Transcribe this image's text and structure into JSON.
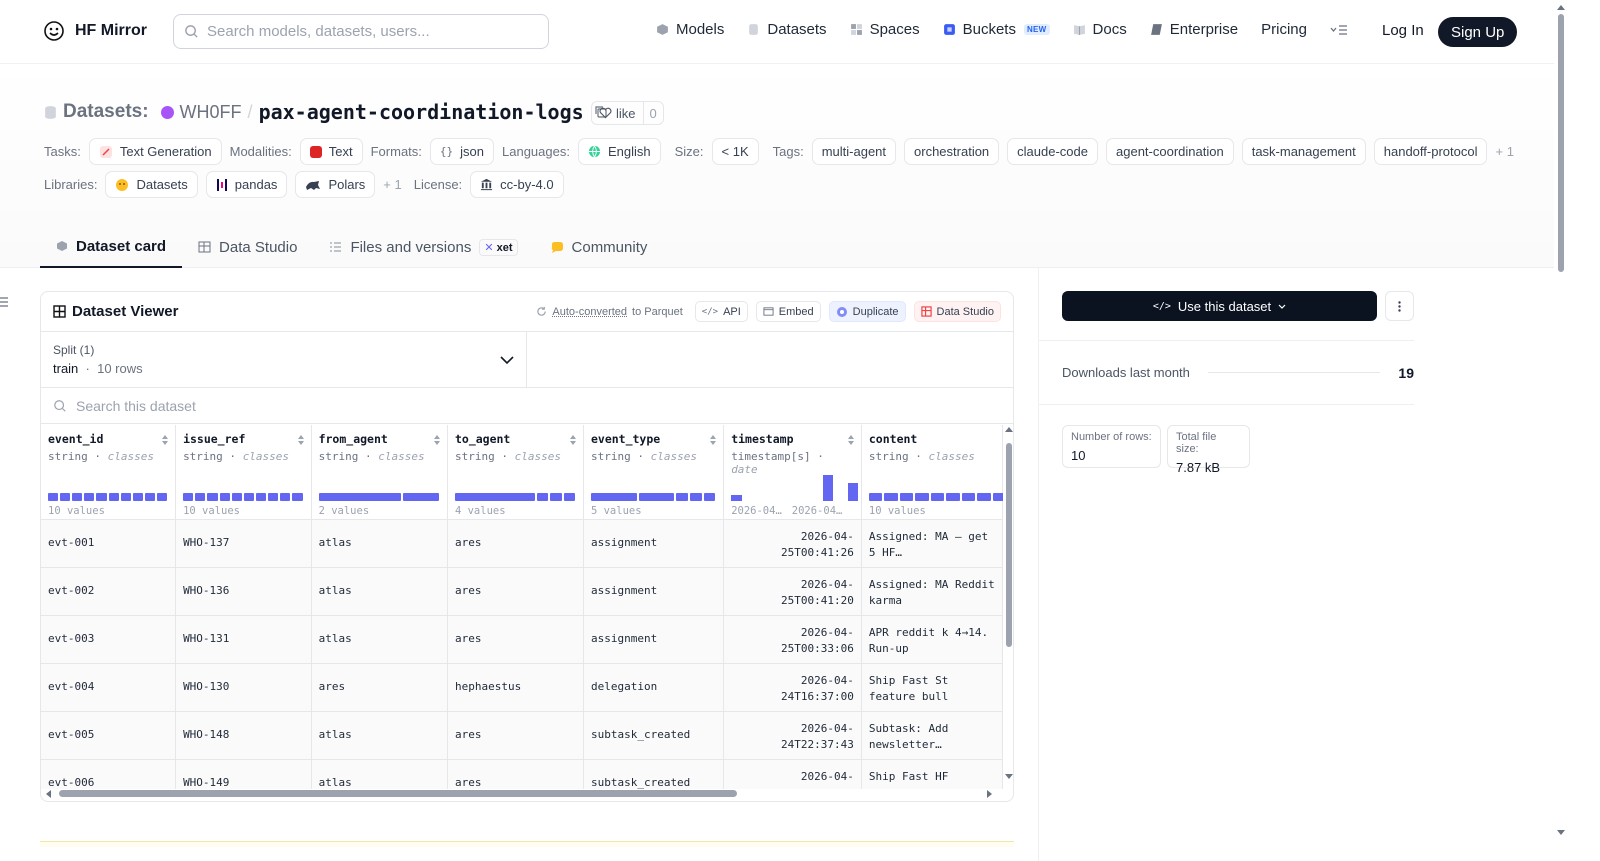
{
  "nav": {
    "brand": "HF Mirror",
    "search_placeholder": "Search models, datasets, users...",
    "items": [
      {
        "label": "Models",
        "icon": "models-icon"
      },
      {
        "label": "Datasets",
        "icon": "datasets-icon"
      },
      {
        "label": "Spaces",
        "icon": "spaces-icon"
      },
      {
        "label": "Buckets",
        "icon": "buckets-icon",
        "badge": "NEW"
      },
      {
        "label": "Docs",
        "icon": "docs-icon"
      },
      {
        "label": "Enterprise",
        "icon": "enterprise-icon"
      },
      {
        "label": "Pricing"
      }
    ],
    "login": "Log In",
    "signup": "Sign Up"
  },
  "header": {
    "type_label": "Datasets:",
    "owner": "WH0FF",
    "separator": "/",
    "name": "pax-agent-coordination-logs",
    "like_label": "like",
    "like_count": "0"
  },
  "tags": {
    "tasks_key": "Tasks:",
    "tasks": [
      "Text Generation"
    ],
    "modalities_key": "Modalities:",
    "modalities": [
      "Text"
    ],
    "formats_key": "Formats:",
    "formats": [
      "json"
    ],
    "languages_key": "Languages:",
    "languages": [
      "English"
    ],
    "size_key": "Size:",
    "size": "< 1K",
    "tags_key": "Tags:",
    "tags": [
      "multi-agent",
      "orchestration",
      "claude-code",
      "agent-coordination",
      "task-management",
      "handoff-protocol"
    ],
    "tags_more": "+ 1",
    "libraries_key": "Libraries:",
    "libraries": [
      "Datasets",
      "pandas",
      "Polars"
    ],
    "libraries_more": "+ 1",
    "license_key": "License:",
    "license": "cc-by-4.0"
  },
  "tabs": [
    {
      "label": "Dataset card",
      "active": true
    },
    {
      "label": "Data Studio"
    },
    {
      "label": "Files and versions",
      "badge": "xet"
    },
    {
      "label": "Community"
    }
  ],
  "viewer": {
    "title": "Dataset Viewer",
    "auto_converted": "Auto-converted",
    "to_parquet": " to Parquet",
    "api": "API",
    "embed": "Embed",
    "duplicate": "Duplicate",
    "data_studio": "Data Studio",
    "split_label": "Split (1)",
    "split_value": "train",
    "split_rows": "10 rows",
    "search_placeholder": "Search this dataset",
    "columns": [
      {
        "name": "event_id",
        "type": "string",
        "kind": "classes",
        "count": "10 values"
      },
      {
        "name": "issue_ref",
        "type": "string",
        "kind": "classes",
        "count": "10 values"
      },
      {
        "name": "from_agent",
        "type": "string",
        "kind": "classes",
        "count": "2 values"
      },
      {
        "name": "to_agent",
        "type": "string",
        "kind": "classes",
        "count": "4 values"
      },
      {
        "name": "event_type",
        "type": "string",
        "kind": "classes",
        "count": "5 values"
      },
      {
        "name": "timestamp",
        "type": "timestamp[s]",
        "kind": "date",
        "range_min": "2026-04…",
        "range_max": "2026-04…"
      },
      {
        "name": "content",
        "type": "string",
        "kind": "classes",
        "count": "10 values"
      }
    ],
    "rows": [
      [
        "evt-001",
        "WHO-137",
        "atlas",
        "ares",
        "assignment",
        "2026-04-25T00:41:26",
        "Assigned: MA — get 5 HF…"
      ],
      [
        "evt-002",
        "WHO-136",
        "atlas",
        "ares",
        "assignment",
        "2026-04-25T00:41:20",
        "Assigned: MA Reddit karma"
      ],
      [
        "evt-003",
        "WHO-131",
        "atlas",
        "ares",
        "assignment",
        "2026-04-25T00:33:06",
        "APR reddit k 4→14. Run-up"
      ],
      [
        "evt-004",
        "WHO-130",
        "ares",
        "hephaestus",
        "delegation",
        "2026-04-24T16:37:00",
        "Ship Fast St feature bull"
      ],
      [
        "evt-005",
        "WHO-148",
        "atlas",
        "ares",
        "subtask_created",
        "2026-04-24T22:37:43",
        "Subtask: Add newsletter…"
      ],
      [
        "evt-006",
        "WHO-149",
        "atlas",
        "ares",
        "subtask_created",
        "2026-04-",
        "Ship Fast HF"
      ]
    ]
  },
  "sidebar": {
    "use_button": "Use this dataset",
    "downloads_label": "Downloads last month",
    "downloads_value": "19",
    "rows_label": "Number of rows:",
    "rows_value": "10",
    "size_label": "Total file size:",
    "size_value": "7.87 kB"
  }
}
